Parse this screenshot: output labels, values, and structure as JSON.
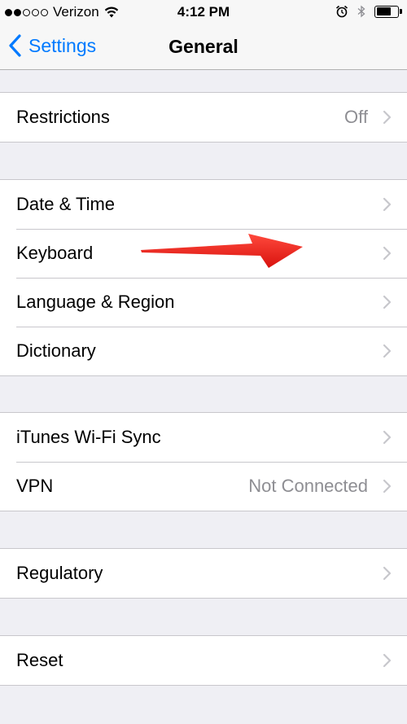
{
  "status_bar": {
    "carrier": "Verizon",
    "time": "4:12 PM",
    "signal_bars_filled": 2,
    "signal_bars_total": 5,
    "battery_level": 0.7
  },
  "nav": {
    "back_label": "Settings",
    "title": "General"
  },
  "groups": [
    {
      "items": [
        {
          "label": "Restrictions",
          "value": "Off"
        }
      ]
    },
    {
      "items": [
        {
          "label": "Date & Time"
        },
        {
          "label": "Keyboard"
        },
        {
          "label": "Language & Region"
        },
        {
          "label": "Dictionary"
        }
      ]
    },
    {
      "items": [
        {
          "label": "iTunes Wi-Fi Sync"
        },
        {
          "label": "VPN",
          "value": "Not Connected"
        }
      ]
    },
    {
      "items": [
        {
          "label": "Regulatory"
        }
      ]
    },
    {
      "items": [
        {
          "label": "Reset"
        }
      ]
    }
  ],
  "colors": {
    "accent": "#007aff",
    "background": "#efeff4",
    "annotation_arrow": "#e8211c",
    "secondary_text": "#8e8e93"
  },
  "icons": {
    "back": "chevron-left-icon",
    "row": "chevron-right-icon",
    "wifi": "wifi-icon",
    "alarm": "alarm-icon",
    "bluetooth": "bluetooth-icon",
    "battery": "battery-icon"
  }
}
